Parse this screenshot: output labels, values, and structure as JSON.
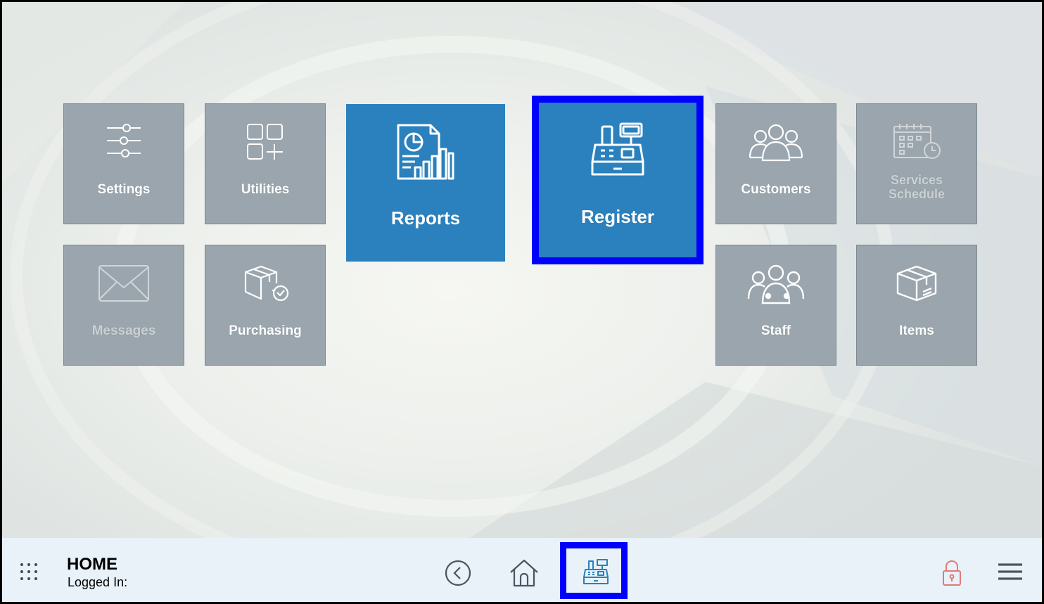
{
  "tiles": {
    "settings": "Settings",
    "utilities": "Utilities",
    "reports": "Reports",
    "register": "Register",
    "customers": "Customers",
    "services_line1": "Services",
    "services_line2": "Schedule",
    "messages": "Messages",
    "purchasing": "Purchasing",
    "staff": "Staff",
    "items": "Items"
  },
  "footer": {
    "title": "HOME",
    "logged_in": "Logged In:"
  },
  "colors": {
    "tile_gray": "#9aa5ad",
    "tile_blue": "#2a81bd",
    "highlight": "#0000ff",
    "footer_bg": "#e8f2f8",
    "lock": "#e07a7a"
  },
  "icons": {
    "settings": "sliders-icon",
    "utilities": "grid-plus-icon",
    "reports": "report-chart-icon",
    "register": "cash-register-icon",
    "customers": "customers-icon",
    "services": "calendar-clock-icon",
    "messages": "envelope-icon",
    "purchasing": "package-check-icon",
    "staff": "staff-icon",
    "items": "box-icon",
    "apps": "apps-grid-icon",
    "back": "back-icon",
    "home": "home-icon",
    "register_footer": "cash-register-icon",
    "lock": "lock-icon",
    "menu": "hamburger-menu-icon"
  }
}
